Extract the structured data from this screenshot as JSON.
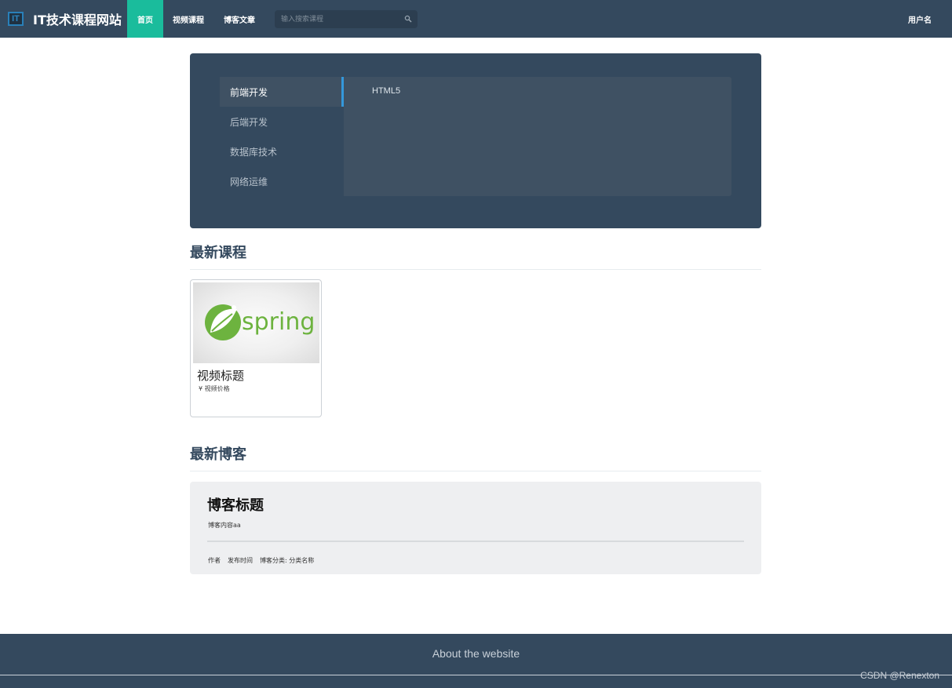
{
  "navbar": {
    "logo_text": "IT",
    "site_title": "IT技术课程网站",
    "nav": {
      "home": "首页",
      "videos": "视频课程",
      "blog": "博客文章"
    },
    "search": {
      "placeholder": "输入搜索课程"
    },
    "user": "用户名",
    "active_color": "#1abc9c",
    "background_color": "#34495e"
  },
  "categories": {
    "items": [
      {
        "label": "前端开发",
        "active": true
      },
      {
        "label": "后端开发",
        "active": false
      },
      {
        "label": "数据库技术",
        "active": false
      },
      {
        "label": "网络运维",
        "active": false
      }
    ],
    "subcategories": [
      "HTML5"
    ],
    "accent_color": "#3498db"
  },
  "latest_courses": {
    "heading": "最新课程",
    "courses": [
      {
        "thumbnail_alt": "spring",
        "title": "视频标题",
        "price": "¥ 视频价格"
      }
    ]
  },
  "latest_blogs": {
    "heading": "最新博客",
    "posts": [
      {
        "title": "博客标题",
        "excerpt": "博客内容aa",
        "author": "作者",
        "published": "发布时间",
        "category": "博客分类: 分类名称"
      }
    ]
  },
  "footer": {
    "about": "About the website",
    "watermark": "CSDN @Renexton"
  }
}
